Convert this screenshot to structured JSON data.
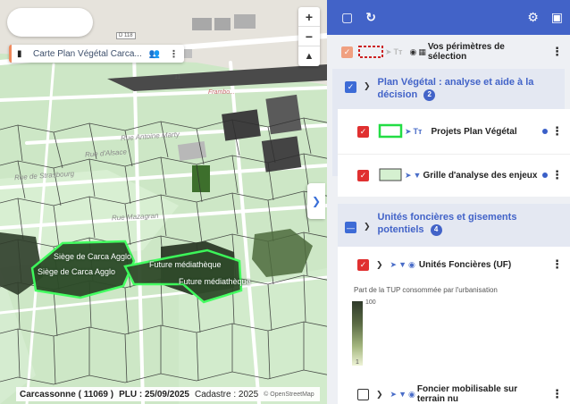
{
  "map": {
    "chip": {
      "title": "Carte Plan Végétal Carca...",
      "book_icon": "book-icon",
      "users_icon": "users-icon",
      "menu_icon": "kebab-icon"
    },
    "zoom": {
      "in": "+",
      "out": "−",
      "compass": "▲"
    },
    "collapse_icon": "chevron-right-icon",
    "road_marker": "D 118",
    "street_labels": [
      {
        "text": "Frambo...",
        "name": "frambo"
      },
      {
        "text": "Rue Antoine Marty",
        "name": "rue-antoine-marty"
      },
      {
        "text": "Rue d'Alsace",
        "name": "rue-alsace"
      },
      {
        "text": "Rue de Strasbourg",
        "name": "rue-strasbourg"
      },
      {
        "text": "Rue Mazagran",
        "name": "rue-mazagran"
      },
      {
        "text": "11",
        "name": "route-number"
      }
    ],
    "zones": [
      {
        "text": "Siège de Carca Agglo",
        "name": "zone-siege-1"
      },
      {
        "text": "Siège de Carca Agglo",
        "name": "zone-siege-2"
      },
      {
        "text": "Future médiathèque",
        "name": "zone-mediatheque-1"
      },
      {
        "text": "Future médiathèque",
        "name": "zone-mediatheque-2"
      }
    ],
    "status": {
      "commune": "Carcassonne ( 11069 )",
      "plu": "PLU : 25/09/2025",
      "cadastre": "Cadastre : 2025",
      "attribution": "© OpenStreetMap"
    }
  },
  "panel": {
    "toolbar": {
      "checkbox_icon": "square-icon",
      "refresh_icon": "refresh-icon",
      "settings_icon": "gear-icon",
      "save_icon": "save-icon"
    },
    "selection_layer": {
      "label": "Vos périmètres de sélection"
    },
    "group_plan": {
      "label": "Plan Végétal : analyse et aide à la décision",
      "count": "2"
    },
    "layer_projets": {
      "label": "Projets Plan Végétal"
    },
    "layer_grille": {
      "label": "Grille d'analyse des enjeux"
    },
    "group_unites": {
      "label": "Unités foncières et gisements potentiels",
      "count": "4"
    },
    "layer_uf": {
      "label": "Unités Foncières (UF)"
    },
    "legend": {
      "title": "Part de la TUP consommée par l'urbanisation",
      "max": "100",
      "min": "1"
    },
    "layer_foncier": {
      "label": "Foncier mobilisable sur terrain nu"
    }
  },
  "colors": {
    "toolbar": "#4263c8",
    "accent_blue": "#4263c8",
    "checkbox_red": "#e03030",
    "project_outline": "#22dd44",
    "map_green": "#cfe8c8"
  }
}
